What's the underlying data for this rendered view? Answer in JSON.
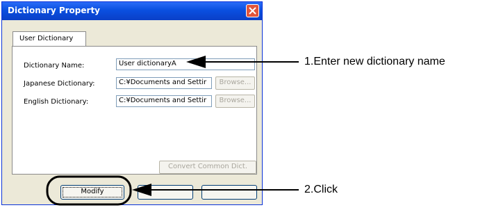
{
  "window": {
    "title": "Dictionary Property"
  },
  "tabs": [
    {
      "label": "User Dictionary"
    }
  ],
  "fields": {
    "dictionary_name": {
      "label": "Dictionary Name:",
      "value": "User dictionaryA"
    },
    "japanese_dictionary": {
      "label": "Japanese Dictionary:",
      "value": "C:¥Documents and Settir",
      "browse": "Browse..."
    },
    "english_dictionary": {
      "label": "English Dictionary:",
      "value": "C:¥Documents and Settir",
      "browse": "Browse..."
    }
  },
  "buttons": {
    "convert": "Convert Common Dict.",
    "modify": "Modify"
  },
  "annotations": {
    "step1": "1.Enter new dictionary name",
    "step2": "2.Click"
  },
  "colors": {
    "title_bar": "#0a4fe0",
    "close_button": "#e2553b",
    "dialog_bg": "#ece9d8"
  }
}
